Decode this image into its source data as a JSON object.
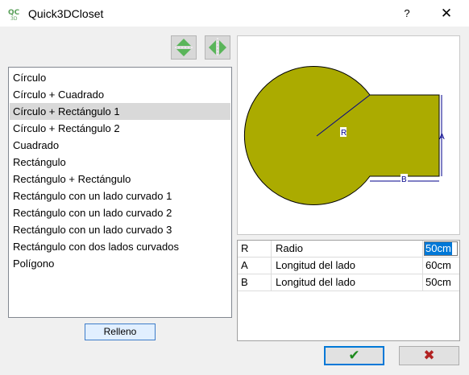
{
  "window": {
    "title": "Quick3DCloset",
    "help_symbol": "?",
    "close_symbol": "✕",
    "app_icon": "qc-3d-logo-icon"
  },
  "toolbar": {
    "buttons": [
      {
        "icon": "flip-vertical-icon",
        "color": "#5ab55a"
      },
      {
        "icon": "flip-horizontal-icon",
        "color": "#5ab55a"
      }
    ]
  },
  "shapes": {
    "items": [
      "Círculo",
      "Círculo + Cuadrado",
      "Círculo + Rectángulo 1",
      "Círculo + Rectángulo 2",
      "Cuadrado",
      "Rectángulo",
      "Rectángulo + Rectángulo",
      "Rectángulo con un lado curvado 1",
      "Rectángulo con un lado curvado 2",
      "Rectángulo con un lado curvado 3",
      "Rectángulo con dos lados curvados",
      "Polígono"
    ],
    "selected_index": 2
  },
  "fill_button": {
    "label": "Relleno"
  },
  "preview": {
    "fill_color": "#abab00",
    "dimension_color": "#00008b",
    "labels": {
      "radius": "R",
      "side_a": "A",
      "side_b": "B"
    }
  },
  "parameters": {
    "rows": [
      {
        "key": "R",
        "name": "Radio",
        "value": "50cm",
        "editing": true
      },
      {
        "key": "A",
        "name": "Longitud del lado",
        "value": "60cm",
        "editing": false
      },
      {
        "key": "B",
        "name": "Longitud del lado",
        "value": "50cm",
        "editing": false
      }
    ]
  },
  "actions": {
    "ok_glyph": "✔",
    "cancel_glyph": "✖",
    "ok_icon": "checkmark-icon",
    "cancel_icon": "x-mark-icon"
  }
}
